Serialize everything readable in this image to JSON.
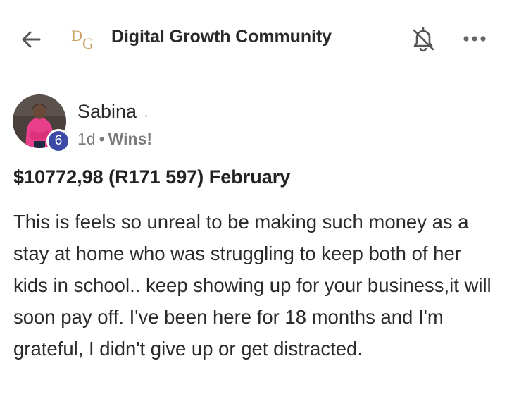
{
  "header": {
    "title": "Digital Growth Community",
    "logo_text": "DG",
    "back_icon": "arrow-left-icon",
    "bell_icon": "bell-off-icon",
    "more_icon": "more-horizontal-icon"
  },
  "post": {
    "author": {
      "name": "Sabina",
      "level": "6"
    },
    "time": "1d",
    "separator": "•",
    "category": "Wins!",
    "title": "$10772,98 (R171 597) February",
    "body": "This is feels so unreal to be making such money as a stay at home who was struggling to keep both of her kids in school.. keep showing up for your business,it will soon pay off. I've been here for 18 months and I'm grateful, I didn't give up or get distracted."
  },
  "colors": {
    "badge": "#3a4aa6",
    "logo_gold": "#c9a063",
    "avatar_pink": "#e83f8a"
  }
}
